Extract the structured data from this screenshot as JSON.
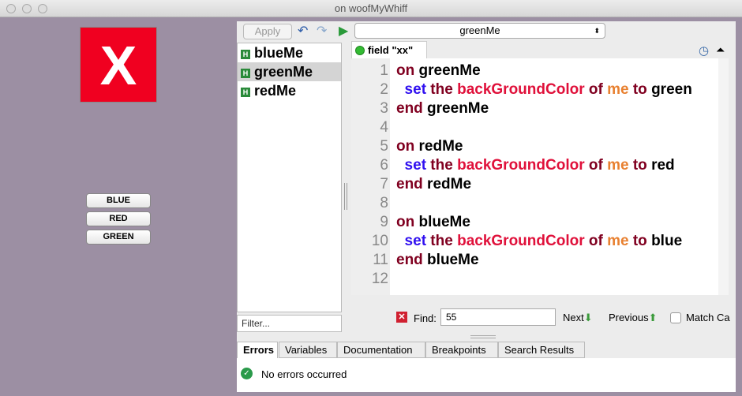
{
  "window": {
    "title": "on woofMyWhiff"
  },
  "card": {
    "x_label": "X",
    "buttons": [
      "BLUE",
      "RED",
      "GREEN"
    ]
  },
  "toolbar": {
    "apply": "Apply",
    "handler_select": "greenMe"
  },
  "handlers": [
    {
      "label": "blueMe",
      "icon": "H"
    },
    {
      "label": "greenMe",
      "icon": "H",
      "selected": true
    },
    {
      "label": "redMe",
      "icon": "H"
    }
  ],
  "filter_placeholder": "Filter...",
  "editor_tab": "field \"xx\"",
  "code": {
    "line_numbers": [
      "1",
      "2",
      "3",
      "4",
      "5",
      "6",
      "7",
      "8",
      "9",
      "10",
      "11",
      "12"
    ],
    "lines": [
      [
        [
          "on",
          "kw"
        ],
        [
          " greenMe",
          "bk"
        ]
      ],
      [
        [
          "  set",
          "bl"
        ],
        [
          " the",
          "kw"
        ],
        [
          " backGroundColor",
          "rd"
        ],
        [
          " of",
          "kw"
        ],
        [
          " me",
          "or"
        ],
        [
          " to",
          "kw"
        ],
        [
          " green",
          "bk"
        ]
      ],
      [
        [
          "end",
          "kw"
        ],
        [
          " greenMe",
          "bk"
        ]
      ],
      [],
      [
        [
          "on",
          "kw"
        ],
        [
          " redMe",
          "bk"
        ]
      ],
      [
        [
          "  set",
          "bl"
        ],
        [
          " the",
          "kw"
        ],
        [
          " backGroundColor",
          "rd"
        ],
        [
          " of",
          "kw"
        ],
        [
          " me",
          "or"
        ],
        [
          " to",
          "kw"
        ],
        [
          " red",
          "bk"
        ]
      ],
      [
        [
          "end",
          "kw"
        ],
        [
          " redMe",
          "bk"
        ]
      ],
      [],
      [
        [
          "on",
          "kw"
        ],
        [
          " blueMe",
          "bk"
        ]
      ],
      [
        [
          "  set",
          "bl"
        ],
        [
          " the",
          "kw"
        ],
        [
          " backGroundColor",
          "rd"
        ],
        [
          " of",
          "kw"
        ],
        [
          " me",
          "or"
        ],
        [
          " to",
          "kw"
        ],
        [
          " blue",
          "bk"
        ]
      ],
      [
        [
          "end",
          "kw"
        ],
        [
          " blueMe",
          "bk"
        ]
      ],
      []
    ]
  },
  "find": {
    "label": "Find:",
    "value": "55",
    "next": "Next",
    "previous": "Previous",
    "match_case": "Match Ca"
  },
  "bottom_tabs": [
    "Errors",
    "Variables",
    "Documentation",
    "Breakpoints",
    "Search Results"
  ],
  "errors": {
    "message": "No errors occurred"
  }
}
